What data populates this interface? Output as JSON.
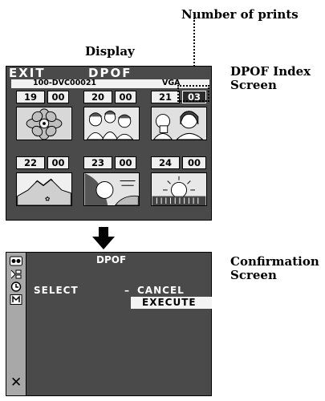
{
  "annotations": {
    "number_of_prints": "Number of prints",
    "display": "Display",
    "dpof_index_screen": "DPOF Index\nScreen",
    "confirmation_screen": "Confirmation\nScreen"
  },
  "index_screen": {
    "exit_label": "EXIT",
    "title": "DPOF",
    "folder": "100-DVC00021",
    "quality": "VGA",
    "row1": [
      {
        "index": "19",
        "prints": "00"
      },
      {
        "index": "20",
        "prints": "00"
      },
      {
        "index": "21",
        "prints": "03"
      }
    ],
    "row2": [
      {
        "index": "22",
        "prints": "00"
      },
      {
        "index": "23",
        "prints": "00"
      },
      {
        "index": "24",
        "prints": "00"
      }
    ]
  },
  "confirmation_screen": {
    "title": "DPOF",
    "select_label": "SELECT",
    "dash": "–",
    "cancel_label": "CANCEL",
    "execute_label": "EXECUTE",
    "close_symbol": "✕"
  }
}
